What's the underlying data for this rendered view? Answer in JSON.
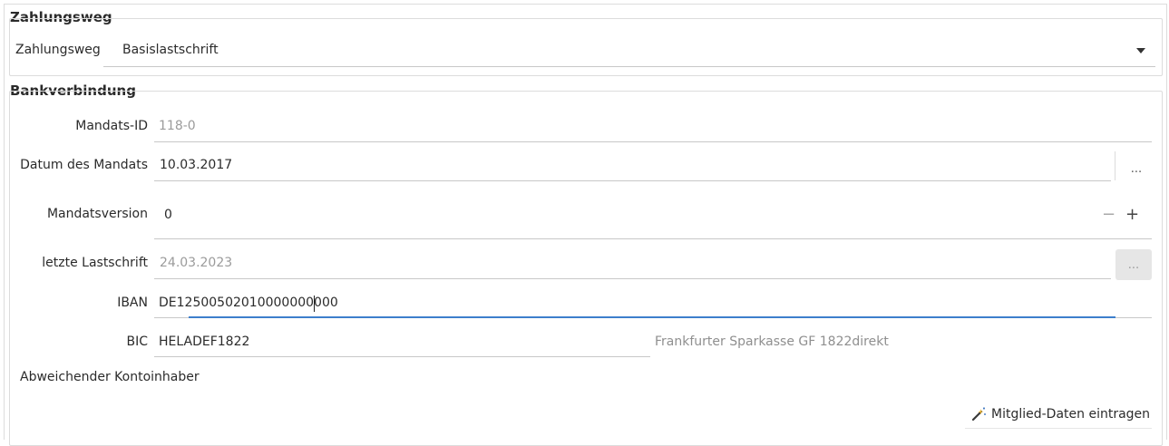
{
  "zahlungsweg": {
    "group_title": "Zahlungsweg",
    "label": "Zahlungsweg",
    "value": "Basislastschrift",
    "dropdown_icon": "triangle-down-icon"
  },
  "bankverbindung": {
    "group_title": "Bankverbindung",
    "mandats_id": {
      "label": "Mandats-ID",
      "value": "118-0"
    },
    "datum_des_mandats": {
      "label": "Datum des Mandats",
      "value": "10.03.2017",
      "button_label": "..."
    },
    "mandatsversion": {
      "label": "Mandatsversion",
      "value": "0",
      "decrement": "−",
      "increment": "+"
    },
    "letzte_lastschrift": {
      "label": "letzte Lastschrift",
      "value": "24.03.2023",
      "button_label": "..."
    },
    "iban": {
      "label": "IBAN",
      "value": "DE12500502010000000000"
    },
    "bic": {
      "label": "BIC",
      "value": "HELADEF1822",
      "bank_name": "Frankfurter Sparkasse GF 1822direkt"
    },
    "abweichender_kontoinhaber": {
      "label": "Abweichender Kontoinhaber"
    },
    "mitglied_button": {
      "label": "Mitglied-Daten eintragen",
      "icon": "magic-wand-icon"
    }
  }
}
